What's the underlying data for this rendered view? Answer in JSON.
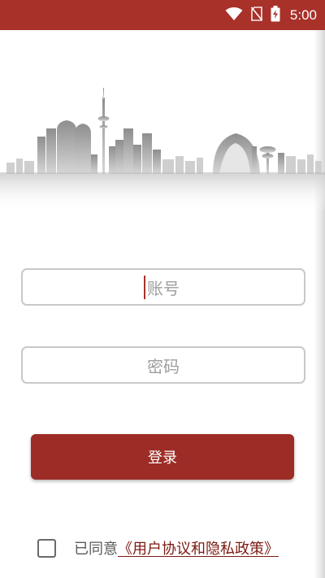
{
  "status_bar": {
    "time": "5:00",
    "icons": [
      "wifi-icon",
      "no-sim-icon",
      "battery-charging-icon"
    ]
  },
  "login": {
    "account_placeholder": "账号",
    "password_placeholder": "密码",
    "login_button": "登录"
  },
  "agreement": {
    "prefix": "已同意",
    "link": "《用户协议和隐私政策》",
    "checked": false
  },
  "colors": {
    "brand": "#a8312a",
    "button": "#9c2c25",
    "input_border": "#c9c9c9",
    "placeholder": "#9e9e9e",
    "link": "#7c1a12"
  }
}
